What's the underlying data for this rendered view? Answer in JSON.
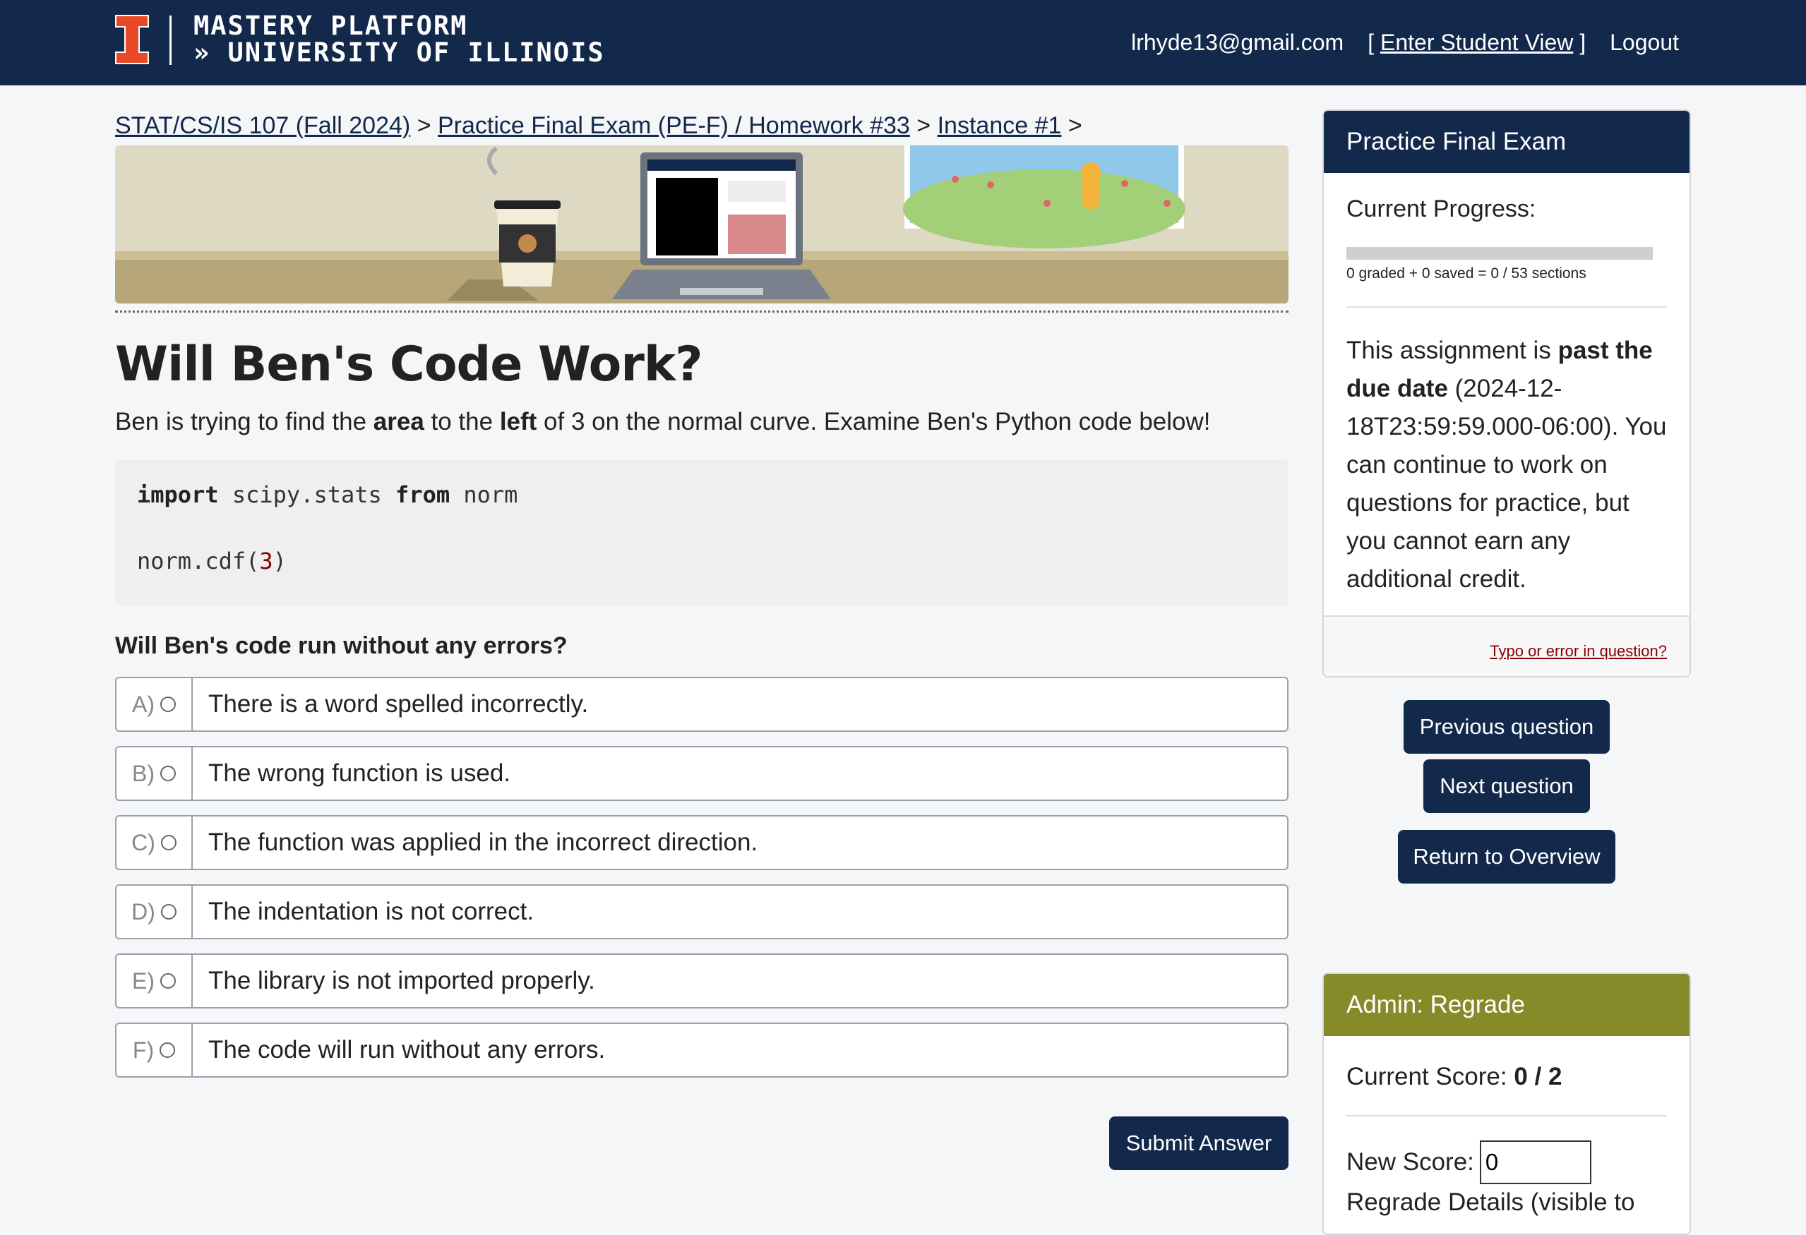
{
  "header": {
    "brand_line1": "MASTERY PLATFORM",
    "brand_line2": "» UNIVERSITY OF ILLINOIS",
    "user_email": "lrhyde13@gmail.com",
    "student_view_open": "[",
    "student_view_label": "Enter Student View",
    "student_view_close": "]",
    "logout_label": "Logout",
    "accent_color": "#e84a27",
    "brand_color": "#13294b"
  },
  "breadcrumb": {
    "course": "STAT/CS/IS 107 (Fall 2024)",
    "sep1": ">",
    "assessment": "Practice Final Exam (PE-F) / Homework #33",
    "sep2": ">",
    "instance": "Instance #1",
    "sep3": ">"
  },
  "question": {
    "title": "Will Ben's Code Work?",
    "prompt_1": "Ben is trying to find the ",
    "prompt_bold_1": "area",
    "prompt_2": " to the ",
    "prompt_bold_2": "left",
    "prompt_3": " of 3 on the normal curve. Examine Ben's Python code below!",
    "code_kw1": "import",
    "code_mod": " scipy.stats ",
    "code_kw2": "from",
    "code_name": " norm",
    "code_call": "norm.cdf(",
    "code_arg": "3",
    "code_close": ")",
    "ask": "Will Ben's code run without any errors?",
    "choices": [
      {
        "key": "A)",
        "text": "There is a word spelled incorrectly."
      },
      {
        "key": "B)",
        "text": "The wrong function is used."
      },
      {
        "key": "C)",
        "text": "The function was applied in the incorrect direction."
      },
      {
        "key": "D)",
        "text": "The indentation is not correct."
      },
      {
        "key": "E)",
        "text": "The library is not imported properly."
      },
      {
        "key": "F)",
        "text": "The code will run without any errors."
      }
    ],
    "submit_label": "Submit Answer"
  },
  "sidebar": {
    "assessment_title": "Practice Final Exam",
    "progress_label": "Current Progress:",
    "progress_fraction": 0,
    "progress_detail": "0 graded + 0 saved = 0 / 53 sections",
    "due_1": "This assignment is ",
    "due_bold": "past the due date",
    "due_2": " (2024-12-18T23:59:59.000-06:00). You can continue to work on questions for practice, but you cannot earn any additional credit.",
    "report_link": "Typo or error in question?",
    "prev_label": "Previous question",
    "next_label": "Next question",
    "overview_label": "Return to Overview",
    "admin_title": "Admin: Regrade",
    "score_label": "Current Score: ",
    "score_value": "0 / 2",
    "new_score_label": "New Score:",
    "new_score_value": "0",
    "regrade_details": "Regrade Details (visible to"
  }
}
